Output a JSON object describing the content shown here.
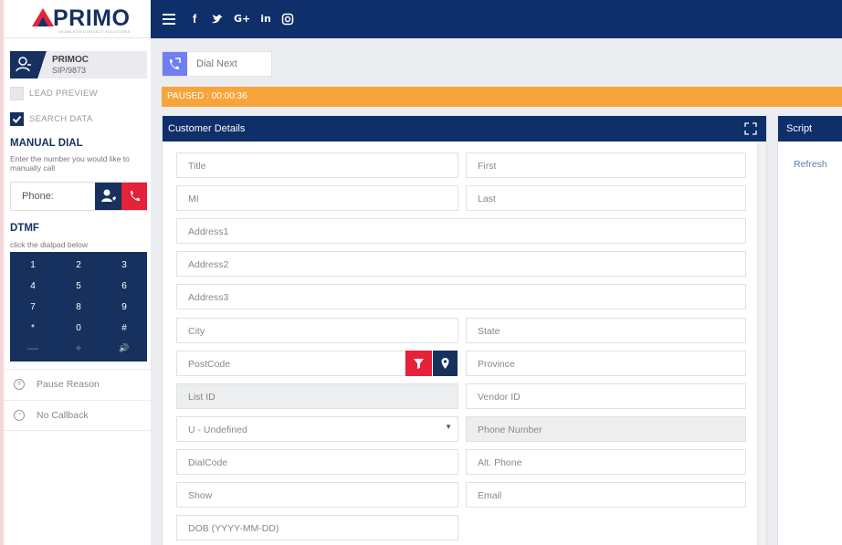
{
  "brand": {
    "name": "PRIMO",
    "tagline": "SEAMLESS CONTACT SOLUTIONS"
  },
  "topbar": {
    "icons": [
      {
        "name": "menu-icon",
        "glyph": "☰"
      },
      {
        "name": "facebook-icon",
        "glyph": "f"
      },
      {
        "name": "twitter-icon",
        "glyph": "🐦"
      },
      {
        "name": "google-plus-icon",
        "glyph": "G+"
      },
      {
        "name": "linkedin-icon",
        "glyph": "in"
      },
      {
        "name": "instagram-icon",
        "glyph": "◎"
      }
    ]
  },
  "agent": {
    "name": "PRIMOC",
    "extension": "SIP/9873"
  },
  "options": {
    "lead_preview": {
      "label": "LEAD PREVIEW",
      "checked": false
    },
    "search_data": {
      "label": "SEARCH DATA",
      "checked": true
    }
  },
  "manual_dial": {
    "title": "MANUAL DIAL",
    "description": "Enter the number you would like to manually call",
    "phone_label": "Phone:"
  },
  "dtmf": {
    "title": "DTMF",
    "description": "click the dialpad below",
    "keys": [
      "1",
      "2",
      "3",
      "4",
      "5",
      "6",
      "7",
      "8",
      "9",
      "*",
      "0",
      "#",
      "—",
      "+",
      "🔊"
    ]
  },
  "side_links": {
    "pause_reason": "Pause Reason",
    "no_callback": "No Callback"
  },
  "main": {
    "dial_next": "Dial Next",
    "status": "PAUSED : 00:00:36"
  },
  "customer": {
    "title": "Customer Details",
    "fields": {
      "title": "Title",
      "first": "First",
      "mi": "MI",
      "last": "Last",
      "address1": "Address1",
      "address2": "Address2",
      "address3": "Address3",
      "city": "City",
      "state": "State",
      "postcode": "PostCode",
      "province": "Province",
      "list_id": "List ID",
      "vendor_id": "Vendor ID",
      "gender": "U - Undefined",
      "phone_number": "Phone Number",
      "dialcode": "DialCode",
      "alt_phone": "Alt. Phone",
      "show": "Show",
      "email": "Email",
      "dob": "DOB (YYYY-MM-DD)"
    }
  },
  "script": {
    "title": "Script",
    "refresh": "Refresh"
  },
  "colors": {
    "navy": "#0e2f6a",
    "navy_dark": "#17315f",
    "red": "#e4223a",
    "orange": "#f7a43a",
    "violet": "#6f7ff2"
  }
}
